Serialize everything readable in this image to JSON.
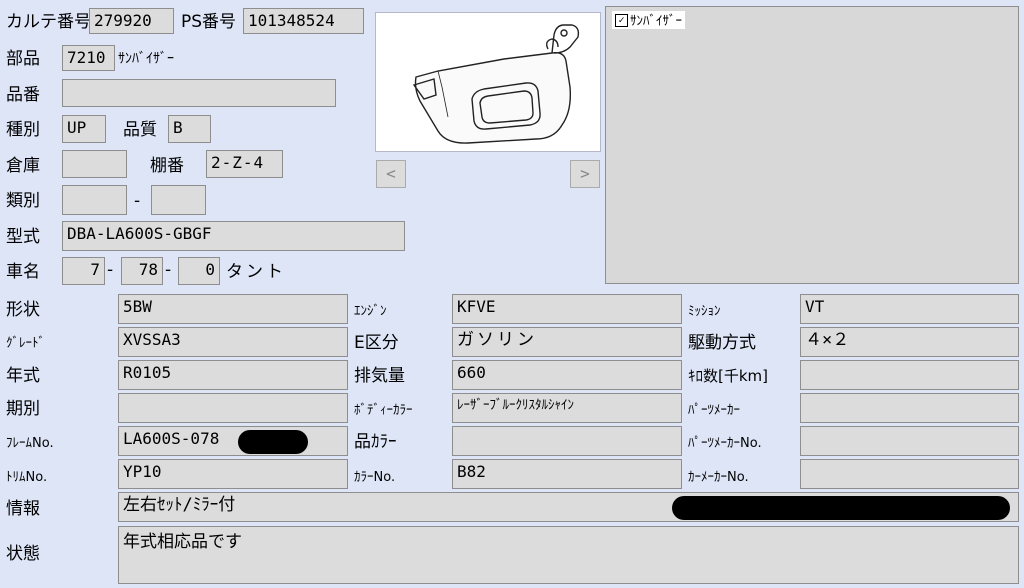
{
  "header": {
    "karte_label": "カルテ番号",
    "karte_value": "279920",
    "ps_label": "PS番号",
    "ps_value": "101348524",
    "part_label": "部品",
    "part_code": "7210",
    "part_name": "ｻﾝﾊﾞｲｻﾞｰ",
    "hinban_label": "品番",
    "hinban_value": "",
    "shubetsu_label": "種別",
    "shubetsu_value": "UP",
    "hinshitsu_label": "品質",
    "hinshitsu_value": "B",
    "souko_label": "倉庫",
    "souko_value": "",
    "tanaban_label": "棚番",
    "tanaban_value": "2-Z-4",
    "ruibetsu_label": "類別",
    "ruibetsu_value1": "",
    "ruibetsu_sep": "-",
    "ruibetsu_value2": "",
    "katashiki_label": "型式",
    "katashiki_value": "DBA-LA600S-GBGF",
    "shamei_label": "車名",
    "shamei_v1": "7",
    "shamei_sep1": "-",
    "shamei_v2": "78",
    "shamei_sep2": "-",
    "shamei_v3": "0",
    "shamei_name": "タント"
  },
  "image_nav": {
    "prev": "<",
    "next": ">"
  },
  "checklist": {
    "item_label": "ｻﾝﾊﾞｲｻﾞｰ",
    "checked": true,
    "check_mark": "✓"
  },
  "details": {
    "keijou_label": "形状",
    "keijou_value": "5BW",
    "engine_label": "ｴﾝｼﾞﾝ",
    "engine_value": "KFVE",
    "mission_label": "ﾐｯｼｮﾝ",
    "mission_value": "VT",
    "grade_label": "ｸﾞﾚｰﾄﾞ",
    "grade_value": "XVSSA3",
    "ekubun_label": "E区分",
    "ekubun_value": "ガソリン",
    "kudou_label": "駆動方式",
    "kudou_value": "４×２",
    "nenshiki_label": "年式",
    "nenshiki_value": "R0105",
    "haikiryou_label": "排気量",
    "haikiryou_value": "660",
    "kilo_label": "ｷﾛ数[千km]",
    "kilo_value": "",
    "kibetsu_label": "期別",
    "kibetsu_value": "",
    "bodycolor_label": "ﾎﾞﾃﾞｨｰｶﾗｰ",
    "bodycolor_value": "ﾚｰｻﾞｰﾌﾞﾙｰｸﾘｽﾀﾙｼｬｲﾝ",
    "partsmaker_label": "ﾊﾟｰﾂﾒｰｶｰ",
    "partsmaker_value": "",
    "frame_label": "ﾌﾚｰﾑNo.",
    "frame_value": "LA600S-078",
    "hincolor_label": "品ｶﾗｰ",
    "hincolor_value": "",
    "partsmakerno_label": "ﾊﾟｰﾂﾒｰｶｰNo.",
    "partsmakerno_value": "",
    "trim_label": "ﾄﾘﾑNo.",
    "trim_value": "YP10",
    "colorno_label": "ｶﾗｰNo.",
    "colorno_value": "B82",
    "carmakerno_label": "ｶｰﾒｰｶｰNo.",
    "carmakerno_value": ""
  },
  "info": {
    "jouhou_label": "情報",
    "jouhou_value": "左右ｾｯﾄ/ﾐﾗｰ付",
    "joutai_label": "状態",
    "joutai_value": "年式相応品です"
  }
}
